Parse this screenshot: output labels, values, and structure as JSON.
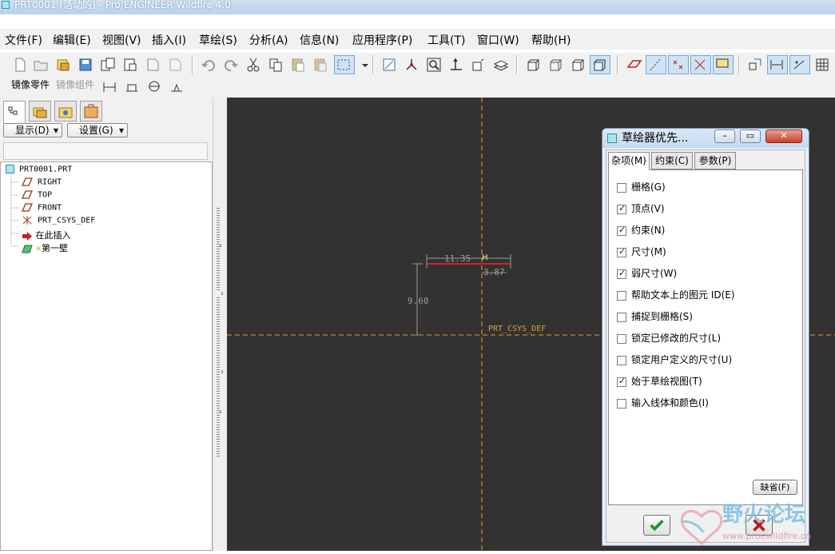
{
  "window": {
    "title": "PRT0001 (活动的) - Pro/ENGINEER Wildfire 4.0"
  },
  "menu": [
    "文件(F)",
    "编辑(E)",
    "视图(V)",
    "插入(I)",
    "草绘(S)",
    "分析(A)",
    "信息(N)",
    "应用程序(P)",
    "工具(T)",
    "窗口(W)",
    "帮助(H)"
  ],
  "toolbar2": {
    "mirror_part": "镜像零件",
    "mirror_assembly": "镜像组件"
  },
  "panel": {
    "display_label": "显示(D)",
    "settings_label": "设置(G)",
    "tree": [
      {
        "label": "PRT0001.PRT",
        "icon": "part-icon"
      },
      {
        "label": "RIGHT",
        "icon": "datum-plane-icon"
      },
      {
        "label": "TOP",
        "icon": "datum-plane-icon"
      },
      {
        "label": "FRONT",
        "icon": "datum-plane-icon"
      },
      {
        "label": "PRT_CSYS_DEF",
        "icon": "csys-icon"
      },
      {
        "label": "在此插入",
        "icon": "insert-arrow-icon"
      },
      {
        "label": "第一壁",
        "icon": "wall-feature-icon"
      }
    ]
  },
  "sketch": {
    "dim_horizontal": "11.35",
    "dim_right": "3.87",
    "dim_vertical": "9.60",
    "csys_label": "PRT_CSYS_DEF",
    "constraint_label": "H"
  },
  "dialog": {
    "title": "草绘器优先...",
    "tabs": [
      "杂项(M)",
      "约束(C)",
      "参数(P)"
    ],
    "options": [
      {
        "label": "栅格(G)",
        "checked": false
      },
      {
        "label": "顶点(V)",
        "checked": true
      },
      {
        "label": "约束(N)",
        "checked": true
      },
      {
        "label": "尺寸(M)",
        "checked": true
      },
      {
        "label": "弱尺寸(W)",
        "checked": true
      },
      {
        "label": "帮助文本上的图元 ID(E)",
        "checked": false
      },
      {
        "label": "捕捉到栅格(S)",
        "checked": false
      },
      {
        "label": "锁定已修改的尺寸(L)",
        "checked": false
      },
      {
        "label": "锁定用户定义的尺寸(U)",
        "checked": false
      },
      {
        "label": "始于草绘视图(T)",
        "checked": true
      },
      {
        "label": "输入线体和颜色(I)",
        "checked": false
      }
    ],
    "default_button": "缺省(F)"
  },
  "watermark": {
    "text": "野火论坛",
    "url": "www.proewildfire.cn"
  },
  "colors": {
    "canvas": "#333230",
    "centerline": "#e0a040",
    "sketch_line": "#d02030",
    "dimension": "#9a9a9a"
  }
}
